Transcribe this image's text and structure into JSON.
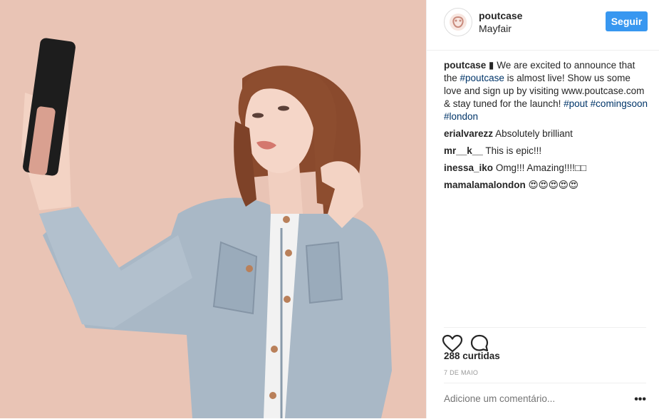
{
  "header": {
    "username": "poutcase",
    "location": "Mayfair",
    "follow_label": "Seguir"
  },
  "caption": {
    "username": "poutcase",
    "parts": [
      "▮ We are excited to announce that the ",
      "#poutcase",
      " is almost live! Show us some love and sign up by visiting www.poutcase.com & stay tuned for the launch! ",
      "#pout",
      "#comingsoon",
      "#london"
    ]
  },
  "comments": [
    {
      "user": "erialvarezz",
      "text": "Absolutely brilliant"
    },
    {
      "user": "mr__k__",
      "text": "This is epic!!!"
    },
    {
      "user": "inessa_iko",
      "text": "Omg!!! Amazing!!!!□□"
    },
    {
      "user": "mamalamalondon",
      "text": "😍😍😍😍😍"
    }
  ],
  "actions": {
    "like_icon": "heart-icon",
    "comment_icon": "comment-icon"
  },
  "likes": "288 curtidas",
  "date": "7 DE MAIO",
  "add_comment": {
    "placeholder": "Adicione um comentário...",
    "more_label": "•••"
  },
  "colors": {
    "follow_button": "#3897f0",
    "hashtag": "#003569",
    "photo_background": "#e9c4b5"
  }
}
